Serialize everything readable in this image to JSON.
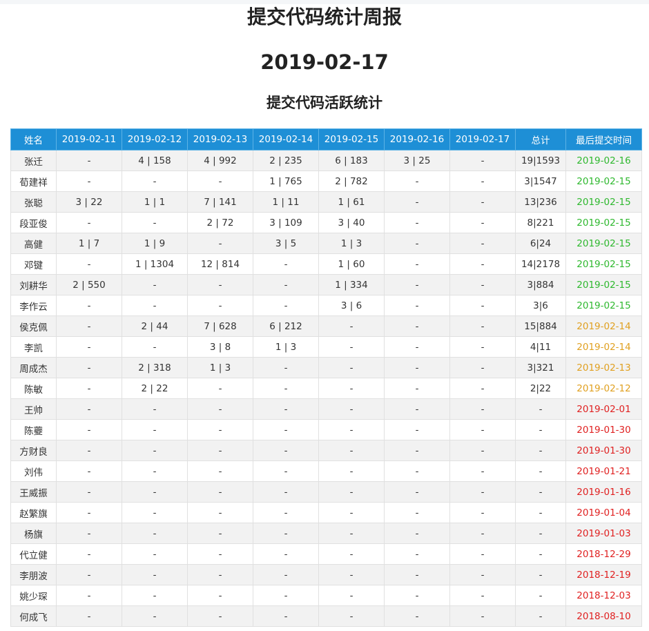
{
  "report": {
    "title": "提交代码统计周报",
    "date": "2019-02-17",
    "subtitle": "提交代码活跃统计"
  },
  "colors": {
    "header_bg": "#1e8fd6",
    "recent": "#2eb82e",
    "mid": "#e0a020",
    "stale": "#e02020"
  },
  "table": {
    "headers": [
      "姓名",
      "2019-02-11",
      "2019-02-12",
      "2019-02-13",
      "2019-02-14",
      "2019-02-15",
      "2019-02-16",
      "2019-02-17",
      "总计",
      "最后提交时间"
    ],
    "rows": [
      {
        "cells": [
          "张迁",
          "-",
          "4 | 158",
          "4 | 992",
          "2 | 235",
          "6 | 183",
          "3 | 25",
          "-",
          "19|1593"
        ],
        "last": "2019-02-16",
        "status": "green"
      },
      {
        "cells": [
          "荀建祥",
          "-",
          "-",
          "-",
          "1 | 765",
          "2 | 782",
          "-",
          "-",
          "3|1547"
        ],
        "last": "2019-02-15",
        "status": "green"
      },
      {
        "cells": [
          "张聪",
          "3 | 22",
          "1 | 1",
          "7 | 141",
          "1 | 11",
          "1 | 61",
          "-",
          "-",
          "13|236"
        ],
        "last": "2019-02-15",
        "status": "green"
      },
      {
        "cells": [
          "段亚俊",
          "-",
          "-",
          "2 | 72",
          "3 | 109",
          "3 | 40",
          "-",
          "-",
          "8|221"
        ],
        "last": "2019-02-15",
        "status": "green"
      },
      {
        "cells": [
          "高健",
          "1 | 7",
          "1 | 9",
          "-",
          "3 | 5",
          "1 | 3",
          "-",
          "-",
          "6|24"
        ],
        "last": "2019-02-15",
        "status": "green"
      },
      {
        "cells": [
          "邓键",
          "-",
          "1 | 1304",
          "12 | 814",
          "-",
          "1 | 60",
          "-",
          "-",
          "14|2178"
        ],
        "last": "2019-02-15",
        "status": "green"
      },
      {
        "cells": [
          "刘耕华",
          "2 | 550",
          "-",
          "-",
          "-",
          "1 | 334",
          "-",
          "-",
          "3|884"
        ],
        "last": "2019-02-15",
        "status": "green"
      },
      {
        "cells": [
          "李作云",
          "-",
          "-",
          "-",
          "-",
          "3 | 6",
          "-",
          "-",
          "3|6"
        ],
        "last": "2019-02-15",
        "status": "green"
      },
      {
        "cells": [
          "侯克佩",
          "-",
          "2 | 44",
          "7 | 628",
          "6 | 212",
          "-",
          "-",
          "-",
          "15|884"
        ],
        "last": "2019-02-14",
        "status": "orange"
      },
      {
        "cells": [
          "李凯",
          "-",
          "-",
          "3 | 8",
          "1 | 3",
          "-",
          "-",
          "-",
          "4|11"
        ],
        "last": "2019-02-14",
        "status": "orange"
      },
      {
        "cells": [
          "周成杰",
          "-",
          "2 | 318",
          "1 | 3",
          "-",
          "-",
          "-",
          "-",
          "3|321"
        ],
        "last": "2019-02-13",
        "status": "orange"
      },
      {
        "cells": [
          "陈敏",
          "-",
          "2 | 22",
          "-",
          "-",
          "-",
          "-",
          "-",
          "2|22"
        ],
        "last": "2019-02-12",
        "status": "orange"
      },
      {
        "cells": [
          "王帅",
          "-",
          "-",
          "-",
          "-",
          "-",
          "-",
          "-",
          "-"
        ],
        "last": "2019-02-01",
        "status": "red"
      },
      {
        "cells": [
          "陈虁",
          "-",
          "-",
          "-",
          "-",
          "-",
          "-",
          "-",
          "-"
        ],
        "last": "2019-01-30",
        "status": "red"
      },
      {
        "cells": [
          "方财良",
          "-",
          "-",
          "-",
          "-",
          "-",
          "-",
          "-",
          "-"
        ],
        "last": "2019-01-30",
        "status": "red"
      },
      {
        "cells": [
          "刘伟",
          "-",
          "-",
          "-",
          "-",
          "-",
          "-",
          "-",
          "-"
        ],
        "last": "2019-01-21",
        "status": "red"
      },
      {
        "cells": [
          "王威振",
          "-",
          "-",
          "-",
          "-",
          "-",
          "-",
          "-",
          "-"
        ],
        "last": "2019-01-16",
        "status": "red"
      },
      {
        "cells": [
          "赵繁旗",
          "-",
          "-",
          "-",
          "-",
          "-",
          "-",
          "-",
          "-"
        ],
        "last": "2019-01-04",
        "status": "red"
      },
      {
        "cells": [
          "杨旗",
          "-",
          "-",
          "-",
          "-",
          "-",
          "-",
          "-",
          "-"
        ],
        "last": "2019-01-03",
        "status": "red"
      },
      {
        "cells": [
          "代立健",
          "-",
          "-",
          "-",
          "-",
          "-",
          "-",
          "-",
          "-"
        ],
        "last": "2018-12-29",
        "status": "red"
      },
      {
        "cells": [
          "李朋波",
          "-",
          "-",
          "-",
          "-",
          "-",
          "-",
          "-",
          "-"
        ],
        "last": "2018-12-19",
        "status": "red"
      },
      {
        "cells": [
          "姚少琛",
          "-",
          "-",
          "-",
          "-",
          "-",
          "-",
          "-",
          "-"
        ],
        "last": "2018-12-03",
        "status": "red"
      },
      {
        "cells": [
          "何成飞",
          "-",
          "-",
          "-",
          "-",
          "-",
          "-",
          "-",
          "-"
        ],
        "last": "2018-08-10",
        "status": "red"
      }
    ]
  }
}
